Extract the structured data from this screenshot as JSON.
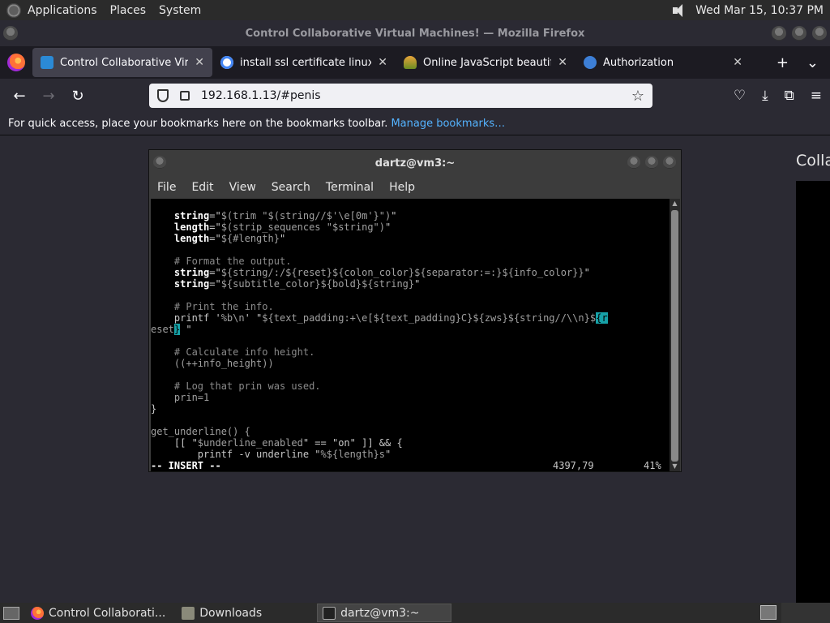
{
  "top_panel": {
    "menus": [
      "Applications",
      "Places",
      "System"
    ],
    "clock": "Wed Mar 15, 10:37 PM"
  },
  "window": {
    "title": "Control Collaborative Virtual Machines! — Mozilla Firefox"
  },
  "tabs": [
    {
      "label": "Control Collaborative Virtual",
      "icon": "monitor-icon",
      "active": true
    },
    {
      "label": "install ssl certificate linux - G",
      "icon": "google-icon",
      "active": false
    },
    {
      "label": "Online JavaScript beautifier",
      "icon": "beautifier-icon",
      "active": false
    },
    {
      "label": "Authorization",
      "icon": "at-sign-icon",
      "active": false
    }
  ],
  "navbar": {
    "url": "192.168.1.13/#penis"
  },
  "bookmarks": {
    "message": "For quick access, place your bookmarks here on the bookmarks toolbar.",
    "link": "Manage bookmarks…"
  },
  "page": {
    "right_title": "Colla"
  },
  "terminal": {
    "title": "dartz@vm3:~",
    "menu": [
      "File",
      "Edit",
      "View",
      "Search",
      "Terminal",
      "Help"
    ],
    "status_mode": "-- INSERT --",
    "status_pos": "4397,79",
    "status_pct": "41%"
  },
  "taskbar": {
    "items": [
      {
        "label": "Control Collaborati...",
        "icon": "firefox-icon"
      },
      {
        "label": "Downloads",
        "icon": "folder-icon"
      },
      {
        "label": "dartz@vm3:~",
        "icon": "terminal-icon"
      }
    ]
  },
  "colors": {
    "cursor": "#17a2a8",
    "link": "#54b3ff"
  }
}
